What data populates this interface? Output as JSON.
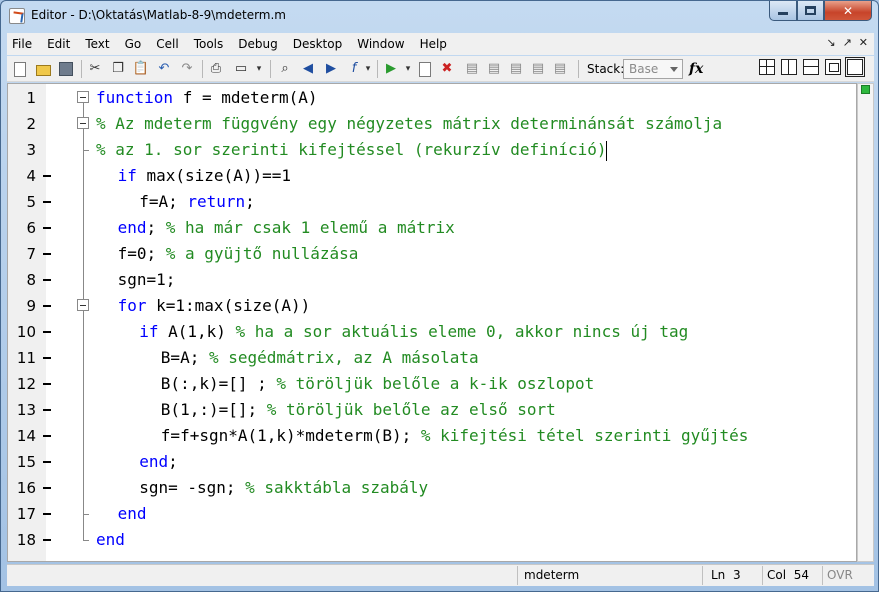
{
  "window": {
    "title": "Editor - D:\\Oktatás\\Matlab-8-9\\mdeterm.m",
    "controls": [
      "minimize",
      "maximize",
      "close"
    ]
  },
  "menu": [
    "File",
    "Edit",
    "Text",
    "Go",
    "Cell",
    "Tools",
    "Debug",
    "Desktop",
    "Window",
    "Help"
  ],
  "menu_right_icons": [
    "undock-arrow-icon",
    "dock-arrow-icon",
    "close-x-icon"
  ],
  "toolbar": {
    "icons": [
      "new-file-icon",
      "open-folder-icon",
      "save-icon",
      "cut-icon",
      "copy-icon",
      "paste-icon",
      "undo-icon",
      "redo-icon",
      "print-icon",
      "print-preview-icon",
      "find-icon",
      "back-arrow-icon",
      "forward-arrow-icon",
      "function-browser-icon",
      "run-icon",
      "set-breakpoint-icon",
      "clear-breakpoints-icon",
      "step-icon",
      "step-in-icon",
      "step-out-icon",
      "continue-icon",
      "exit-debug-icon"
    ],
    "stack_label": "Stack:",
    "stack_value": "Base",
    "fx_label": "fx"
  },
  "editor": {
    "lines": [
      {
        "n": "1",
        "dash": false,
        "fold": "box",
        "indent": 0,
        "parts": [
          {
            "t": "function",
            "c": "kw"
          },
          {
            "t": " f = mdeterm(A)",
            "c": "tx"
          }
        ]
      },
      {
        "n": "2",
        "dash": false,
        "fold": "box",
        "indent": 0,
        "parts": [
          {
            "t": "% Az mdeterm függvény egy négyzetes mátrix determinánsát számolja",
            "c": "cm"
          }
        ]
      },
      {
        "n": "3",
        "dash": false,
        "fold": "end",
        "indent": 0,
        "parts": [
          {
            "t": "% az 1. sor szerinti kifejtéssel (rekurzív definíció)",
            "c": "cm"
          }
        ]
      },
      {
        "n": "4",
        "dash": true,
        "fold": "",
        "indent": 1,
        "parts": [
          {
            "t": "if",
            "c": "kw"
          },
          {
            "t": " max(size(A))==1",
            "c": "tx"
          }
        ]
      },
      {
        "n": "5",
        "dash": true,
        "fold": "",
        "indent": 2,
        "parts": [
          {
            "t": "f=A; ",
            "c": "tx"
          },
          {
            "t": "return",
            "c": "kw"
          },
          {
            "t": ";",
            "c": "tx"
          }
        ]
      },
      {
        "n": "6",
        "dash": true,
        "fold": "",
        "indent": 1,
        "parts": [
          {
            "t": "end",
            "c": "kw"
          },
          {
            "t": "; ",
            "c": "tx"
          },
          {
            "t": "% ha már csak 1 elemű a mátrix",
            "c": "cm"
          }
        ]
      },
      {
        "n": "7",
        "dash": true,
        "fold": "",
        "indent": 1,
        "parts": [
          {
            "t": "f=0; ",
            "c": "tx"
          },
          {
            "t": "% a gyüjtő nullázása",
            "c": "cm"
          }
        ]
      },
      {
        "n": "8",
        "dash": true,
        "fold": "",
        "indent": 1,
        "parts": [
          {
            "t": "sgn=1;",
            "c": "tx"
          }
        ]
      },
      {
        "n": "9",
        "dash": true,
        "fold": "box",
        "indent": 1,
        "parts": [
          {
            "t": "for",
            "c": "kw"
          },
          {
            "t": " k=1:max(size(A))",
            "c": "tx"
          }
        ]
      },
      {
        "n": "10",
        "dash": true,
        "fold": "",
        "indent": 2,
        "parts": [
          {
            "t": "if",
            "c": "kw"
          },
          {
            "t": " A(1,k) ",
            "c": "tx"
          },
          {
            "t": "% ha a sor aktuális eleme 0, akkor nincs új tag",
            "c": "cm"
          }
        ]
      },
      {
        "n": "11",
        "dash": true,
        "fold": "",
        "indent": 3,
        "parts": [
          {
            "t": "B=A; ",
            "c": "tx"
          },
          {
            "t": "% segédmátrix, az A másolata",
            "c": "cm"
          }
        ]
      },
      {
        "n": "12",
        "dash": true,
        "fold": "",
        "indent": 3,
        "parts": [
          {
            "t": "B(:,k)=[] ; ",
            "c": "tx"
          },
          {
            "t": "% töröljük belőle a k-ik oszlopot",
            "c": "cm"
          }
        ]
      },
      {
        "n": "13",
        "dash": true,
        "fold": "",
        "indent": 3,
        "parts": [
          {
            "t": "B(1,:)=[]; ",
            "c": "tx"
          },
          {
            "t": "% töröljük belőle az első sort",
            "c": "cm"
          }
        ]
      },
      {
        "n": "14",
        "dash": true,
        "fold": "",
        "indent": 3,
        "parts": [
          {
            "t": "f=f+sgn*A(1,k)*mdeterm(B); ",
            "c": "tx"
          },
          {
            "t": "% kifejtési tétel szerinti gyűjtés",
            "c": "cm"
          }
        ]
      },
      {
        "n": "15",
        "dash": true,
        "fold": "",
        "indent": 2,
        "parts": [
          {
            "t": "end",
            "c": "kw"
          },
          {
            "t": ";",
            "c": "tx"
          }
        ]
      },
      {
        "n": "16",
        "dash": true,
        "fold": "",
        "indent": 2,
        "parts": [
          {
            "t": "sgn= -sgn; ",
            "c": "tx"
          },
          {
            "t": "% sakktábla szabály",
            "c": "cm"
          }
        ]
      },
      {
        "n": "17",
        "dash": true,
        "fold": "end",
        "indent": 1,
        "parts": [
          {
            "t": "end",
            "c": "kw"
          }
        ]
      },
      {
        "n": "18",
        "dash": true,
        "fold": "end",
        "indent": 0,
        "parts": [
          {
            "t": "end",
            "c": "kw"
          }
        ]
      }
    ],
    "cursor": {
      "line": 3,
      "col": 54
    }
  },
  "status": {
    "function_name": "mdeterm",
    "ln_label": "Ln",
    "ln_value": "3",
    "col_label": "Col",
    "col_value": "54",
    "ovr": "OVR"
  },
  "colors": {
    "keyword": "#0000ff",
    "comment": "#228b22",
    "text": "#000000"
  }
}
